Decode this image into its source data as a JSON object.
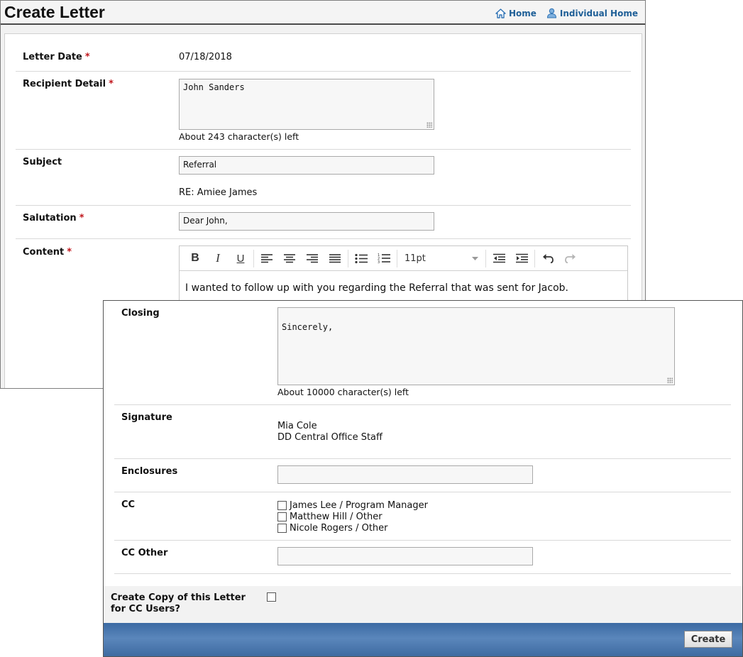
{
  "header": {
    "title": "Create Letter",
    "home_label": "Home",
    "individual_home_label": "Individual Home"
  },
  "form": {
    "letter_date": {
      "label": "Letter Date",
      "value": "07/18/2018",
      "required": "*"
    },
    "recipient_detail": {
      "label": "Recipient Detail",
      "value": "John Sanders",
      "hint": "About 243 character(s) left",
      "required": "*"
    },
    "subject": {
      "label": "Subject",
      "value": "Referral",
      "re_line": "RE: Amiee James"
    },
    "salutation": {
      "label": "Salutation",
      "value": "Dear John,",
      "required": "*"
    },
    "content": {
      "label": "Content",
      "required": "*",
      "font_size": "11pt",
      "body": "I wanted to follow up with you regarding the Referral that was sent for Jacob."
    },
    "closing": {
      "label": "Closing",
      "value": "Sincerely,",
      "hint": "About 10000 character(s) left"
    },
    "signature": {
      "label": "Signature",
      "name": "Mia Cole",
      "title": "DD Central Office Staff"
    },
    "enclosures": {
      "label": "Enclosures",
      "value": ""
    },
    "cc": {
      "label": "CC",
      "options": [
        "James Lee / Program Manager",
        "Matthew Hill / Other",
        "Nicole Rogers / Other"
      ]
    },
    "cc_other": {
      "label": "CC Other",
      "value": ""
    },
    "copy_for_cc": {
      "label": "Create Copy of this Letter for CC Users?"
    }
  },
  "footer": {
    "create_label": "Create"
  },
  "colors": {
    "link": "#1e5f97",
    "required": "#c0151b",
    "footer_bar": "#3b6aa3"
  }
}
